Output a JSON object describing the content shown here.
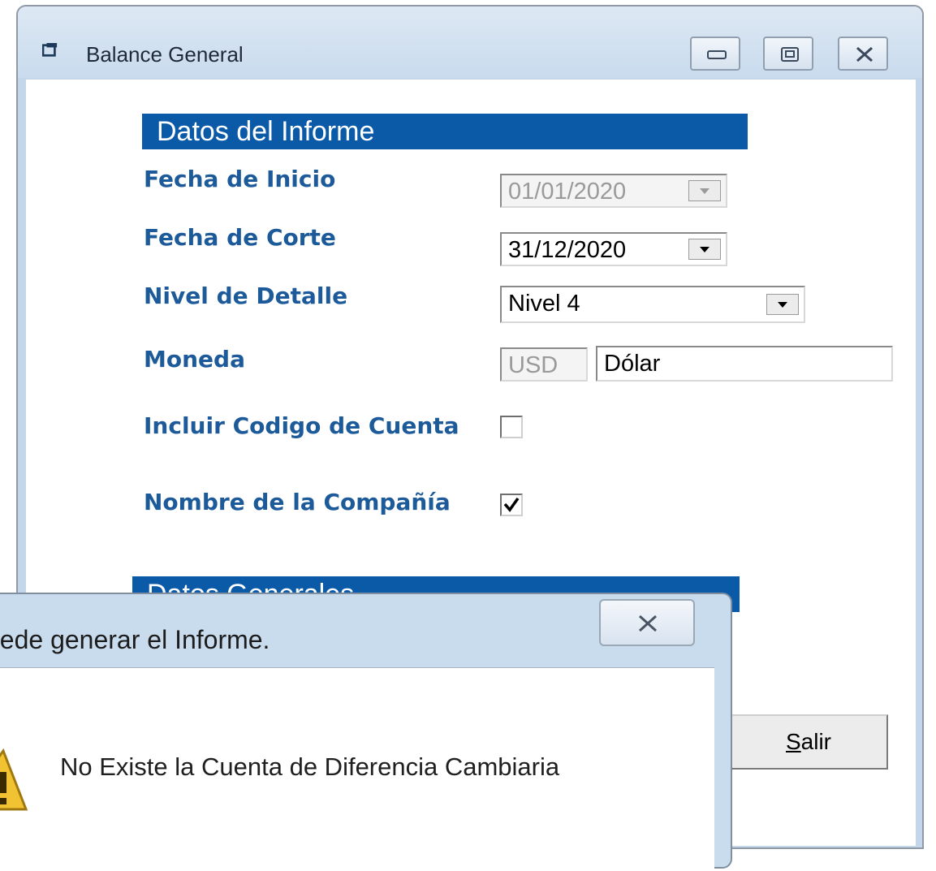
{
  "window": {
    "title": "Balance General"
  },
  "section1": {
    "title": "Datos del Informe"
  },
  "section2": {
    "title": "Datos Generales"
  },
  "form": {
    "fecha_inicio": {
      "label": "Fecha de Inicio",
      "value": "01/01/2020",
      "disabled": true
    },
    "fecha_corte": {
      "label": "Fecha de Corte",
      "value": "31/12/2020"
    },
    "nivel_detalle": {
      "label": "Nivel de Detalle",
      "value": "Nivel 4"
    },
    "moneda": {
      "label": "Moneda",
      "code": "USD",
      "name": "Dólar"
    },
    "incluir_codigo": {
      "label": "Incluir Codigo de Cuenta",
      "checked": false
    },
    "nombre_compania": {
      "label": "Nombre de la Compañía",
      "checked": true
    }
  },
  "buttons": {
    "salir_prefix": "S",
    "salir_rest": "alir"
  },
  "dialog": {
    "title": "uede generar el Informe.",
    "message": "No Existe la Cuenta de Diferencia Cambiaria",
    "icon": "warning-icon"
  },
  "colors": {
    "section_header": "#0a5aa8",
    "label": "#1c5a9a",
    "window_frame": "#c3d6ea"
  }
}
